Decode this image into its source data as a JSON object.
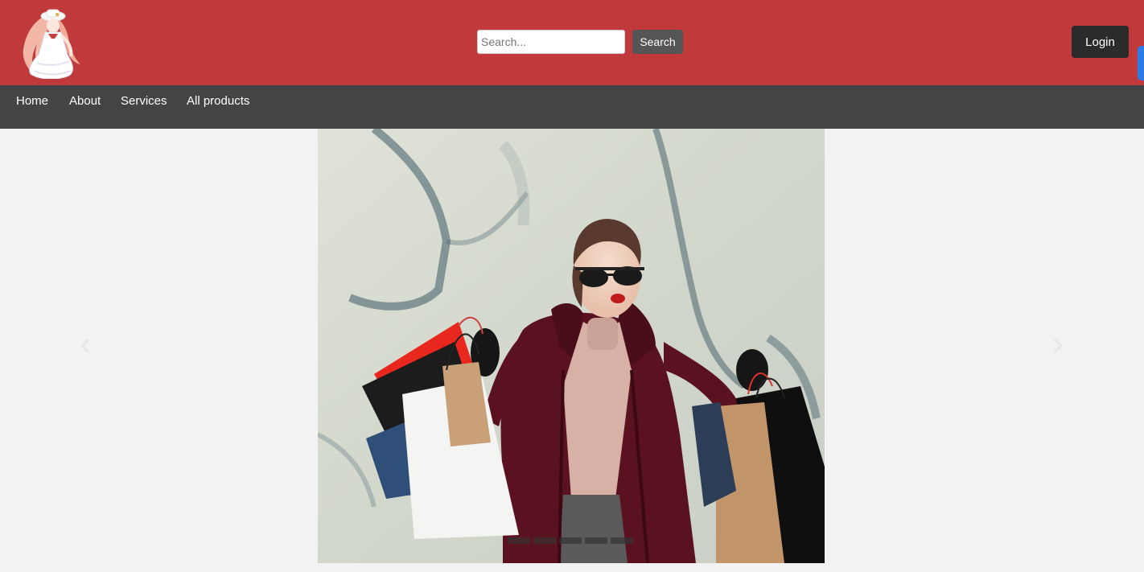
{
  "header": {
    "logo_icon": "anime-girl-logo",
    "search": {
      "placeholder": "Search...",
      "value": "",
      "button_label": "Search"
    },
    "login_label": "Login"
  },
  "nav": {
    "items": [
      {
        "label": "Home"
      },
      {
        "label": "About"
      },
      {
        "label": "Services"
      },
      {
        "label": "All products"
      }
    ]
  },
  "carousel": {
    "slide_image": "woman-with-shopping-bags",
    "prev_icon": "chevron-left-icon",
    "next_icon": "chevron-right-icon",
    "indicator_count": 5,
    "active_indicator": 0
  },
  "colors": {
    "header_bg": "#c0393b",
    "nav_bg": "#444444",
    "page_bg": "#f2f2f2",
    "login_bg": "#2b2b2b",
    "search_button_bg": "#555555",
    "edge_tab": "#2d7be5"
  }
}
